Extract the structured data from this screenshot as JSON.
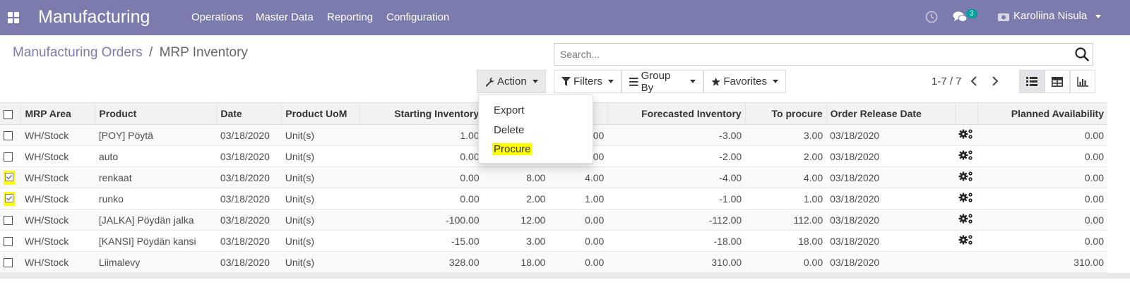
{
  "navbar": {
    "app_title": "Manufacturing",
    "menus": [
      "Operations",
      "Master Data",
      "Reporting",
      "Configuration"
    ],
    "messages_count": "3",
    "user_name": "Karoliina Nisula"
  },
  "breadcrumb": {
    "parent": "Manufacturing Orders",
    "separator": "/",
    "current": "MRP Inventory"
  },
  "search": {
    "placeholder": "Search..."
  },
  "toolbar": {
    "action_label": "Action",
    "filters_label": "Filters",
    "group_by_label": "Group By",
    "favorites_label": "Favorites",
    "pager": "1-7 / 7"
  },
  "action_menu": {
    "items": [
      "Export",
      "Delete",
      "Procure"
    ]
  },
  "table": {
    "columns": [
      "MRP Area",
      "Product",
      "Date",
      "Product UoM",
      "Starting Inventory",
      "",
      "",
      "Forecasted Inventory",
      "To procure",
      "Order Release Date",
      "",
      "Planned Availability"
    ],
    "rows": [
      {
        "area": "WH/Stock",
        "product": "[POY] Pöytä",
        "date": "03/18/2020",
        "uom": "Unit(s)",
        "start": "1.00",
        "c6": "",
        "c7": "00",
        "forecast": "-3.00",
        "procure": "3.00",
        "release": "03/18/2020",
        "avail": "0.00",
        "checked": false,
        "gear": true
      },
      {
        "area": "WH/Stock",
        "product": "auto",
        "date": "03/18/2020",
        "uom": "Unit(s)",
        "start": "0.00",
        "c6": "",
        "c7": "00",
        "forecast": "-2.00",
        "procure": "2.00",
        "release": "03/18/2020",
        "avail": "0.00",
        "checked": false,
        "gear": true
      },
      {
        "area": "WH/Stock",
        "product": "renkaat",
        "date": "03/18/2020",
        "uom": "Unit(s)",
        "start": "0.00",
        "c6": "8.00",
        "c7": "4.00",
        "forecast": "-4.00",
        "procure": "4.00",
        "release": "03/18/2020",
        "avail": "0.00",
        "checked": true,
        "gear": true
      },
      {
        "area": "WH/Stock",
        "product": "runko",
        "date": "03/18/2020",
        "uom": "Unit(s)",
        "start": "0.00",
        "c6": "2.00",
        "c7": "1.00",
        "forecast": "-1.00",
        "procure": "1.00",
        "release": "03/18/2020",
        "avail": "0.00",
        "checked": true,
        "gear": true
      },
      {
        "area": "WH/Stock",
        "product": "[JALKA] Pöydän jalka",
        "date": "03/18/2020",
        "uom": "Unit(s)",
        "start": "-100.00",
        "c6": "12.00",
        "c7": "0.00",
        "forecast": "-112.00",
        "procure": "112.00",
        "release": "03/18/2020",
        "avail": "0.00",
        "checked": false,
        "gear": true
      },
      {
        "area": "WH/Stock",
        "product": "[KANSI] Pöydän kansi",
        "date": "03/18/2020",
        "uom": "Unit(s)",
        "start": "-15.00",
        "c6": "3.00",
        "c7": "0.00",
        "forecast": "-18.00",
        "procure": "18.00",
        "release": "03/18/2020",
        "avail": "0.00",
        "checked": false,
        "gear": true
      },
      {
        "area": "WH/Stock",
        "product": "Liimalevy",
        "date": "03/18/2020",
        "uom": "Unit(s)",
        "start": "328.00",
        "c6": "18.00",
        "c7": "0.00",
        "forecast": "310.00",
        "procure": "0.00",
        "release": "03/18/2020",
        "avail": "310.00",
        "checked": false,
        "gear": false
      }
    ]
  },
  "colors": {
    "brand": "#7c7bad",
    "highlight": "#ffff00",
    "badge": "#00a09d"
  }
}
